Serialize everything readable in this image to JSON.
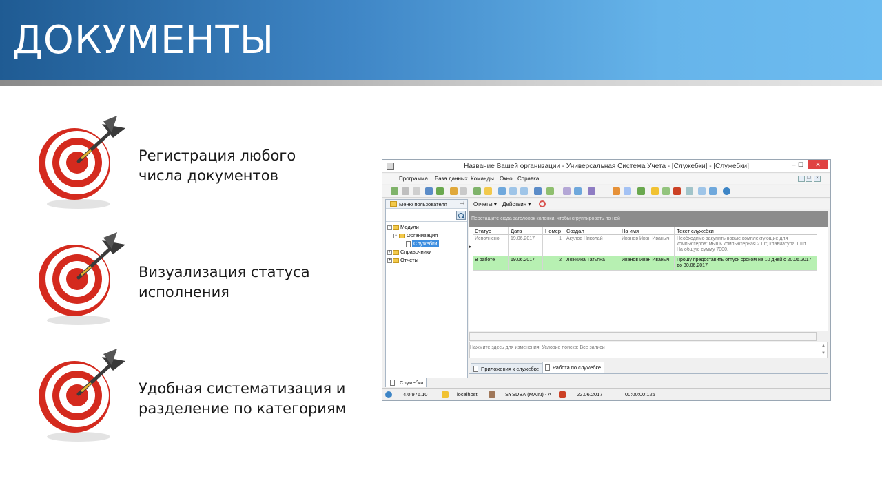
{
  "slide": {
    "title": "ДОКУМЕНТЫ",
    "features": [
      {
        "icon": "target-dart-icon",
        "line1": "Регистрация любого",
        "line2": "числа документов"
      },
      {
        "icon": "target-dart-icon",
        "line1": "Визуализация статуса",
        "line2": "исполнения"
      },
      {
        "icon": "target-dart-icon",
        "line1": "Удобная систематизация и",
        "line2": "разделение по категориям"
      }
    ]
  },
  "app": {
    "window_title": "Название Вашей организации - Универсальная Система Учета - [Служебки] - [Служебки]",
    "window_buttons": {
      "minimize": "–",
      "maximize": "☐",
      "close": "✕"
    },
    "menu": [
      "Программа",
      "База данных",
      "Команды",
      "Окно",
      "Справка"
    ],
    "mdi_buttons": [
      "_",
      "❐",
      "×"
    ],
    "left_panel": {
      "header": "Меню пользователя",
      "pin": "⊣",
      "tree": [
        {
          "label": "Модули",
          "type": "folder",
          "expander": "−"
        },
        {
          "label": "Организация",
          "type": "folder",
          "expander": "−"
        },
        {
          "label": "Служебки",
          "type": "doc",
          "selected": true
        },
        {
          "label": "Справочники",
          "type": "folder",
          "expander": "+"
        },
        {
          "label": "Отчеты",
          "type": "folder",
          "expander": "+"
        }
      ]
    },
    "subtoolbar": {
      "reports": "Отчеты ▾",
      "actions": "Действия ▾"
    },
    "group_hint": "Перетащите сюда заголовок колонки, чтобы сгруппировать по ней",
    "grid": {
      "columns": [
        "Статус",
        "Дата",
        "Номер",
        "Создал",
        "На имя",
        "Текст служебки"
      ],
      "rows": [
        {
          "status": "Исполнено",
          "date": "19.06.2017",
          "number": "1",
          "created_by": "Акулов Николай",
          "addressee": "Иванов Иван Иваныч",
          "text": "Необходимо закупить новые комплектующие для компьютеров: мышь компьютерная 2 шт, клавиатура 1 шт. На общую сумму 7000.",
          "state": "done"
        },
        {
          "status": "В работе",
          "date": "19.06.2017",
          "number": "2",
          "created_by": "Ложкина Татьяна",
          "addressee": "Иванов Иван Иваныч",
          "text": "Прошу предоставить отпуск сроком на 10 дней с 20.06.2017 до 30.06.2017",
          "state": "in_progress"
        }
      ]
    },
    "filter_text": "Нажмите здесь для изменения. Условие поиска: Все записи",
    "detail_tabs": [
      "Приложения к служебке",
      "Работа по служебке"
    ],
    "bottom_tab": "Служебки",
    "status": {
      "version": "4.0.976.10",
      "host": "localhost",
      "db": "SYSDBA (MAIN) - A",
      "date": "22.06.2017",
      "timer": "00:00:00:125"
    },
    "colors": {
      "in_progress_row": "#b7f0b2",
      "close_button": "#e04343",
      "group_area": "#8c8c8c",
      "selection": "#3d8ee0"
    }
  }
}
